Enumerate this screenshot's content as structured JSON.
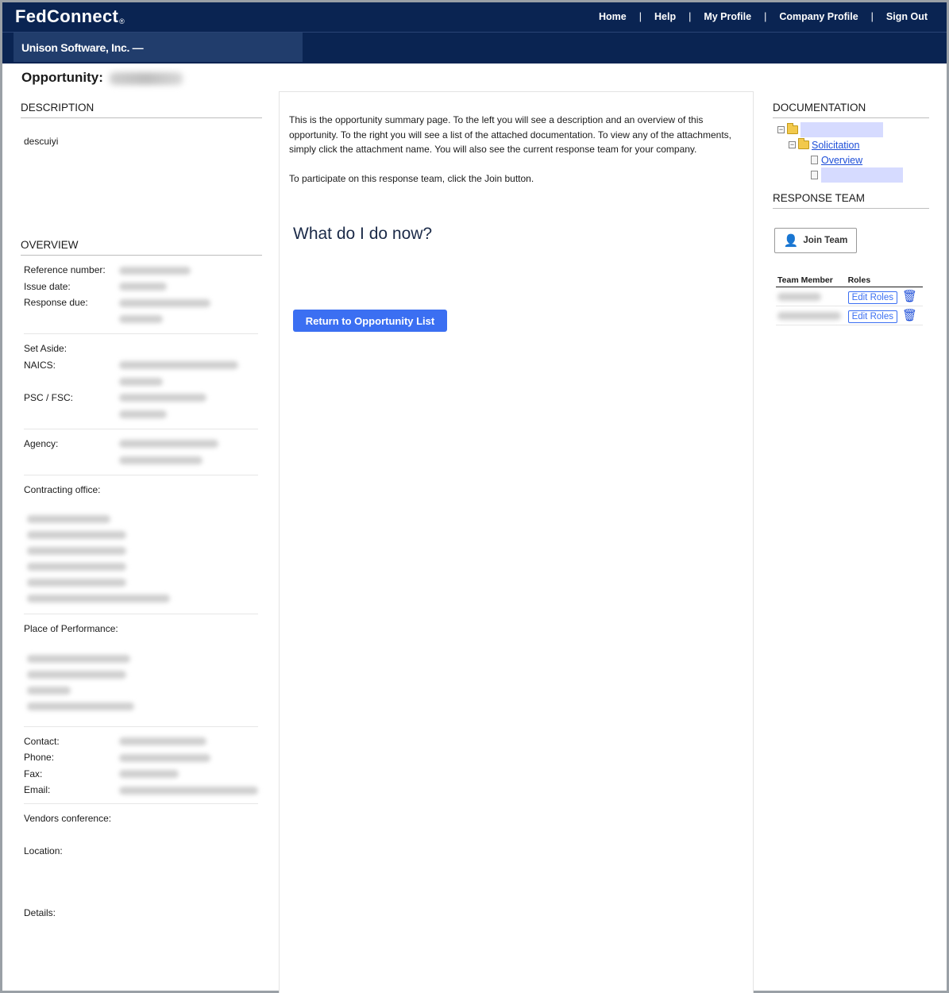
{
  "header": {
    "logo": "FedConnect",
    "logo_mark": "®",
    "nav": [
      "Home",
      "Help",
      "My Profile",
      "Company Profile",
      "Sign Out"
    ],
    "company": "Unison Software, Inc. —"
  },
  "page": {
    "title": "Opportunity:"
  },
  "description": {
    "heading": "DESCRIPTION",
    "text": "descuiyi"
  },
  "overview": {
    "heading": "OVERVIEW",
    "reference_label": "Reference number:",
    "issue_label": "Issue date:",
    "response_label": "Response due:",
    "setaside_label": "Set Aside:",
    "naics_label": "NAICS:",
    "psc_label": "PSC / FSC:",
    "agency_label": "Agency:",
    "office_label": "Contracting office:",
    "place_label": "Place of Performance:",
    "contact_label": "Contact:",
    "phone_label": "Phone:",
    "fax_label": "Fax:",
    "email_label": "Email:",
    "vendors_label": "Vendors conference:",
    "location_label": "Location:",
    "details_label": "Details:"
  },
  "summary": {
    "p1": "This is the opportunity summary page. To the left you will see a description and an overview of this opportunity. To the right you will see a list of the attached documentation. To view any of the attachments, simply click the attachment name. You will also see the current response team for your company.",
    "p2": "To participate on this response team, click the Join button.",
    "question": "What do I do now?",
    "return_button": "Return to Opportunity List"
  },
  "documentation": {
    "heading": "DOCUMENTATION",
    "folder": "Solicitation",
    "file": "Overview"
  },
  "team": {
    "heading": "RESPONSE TEAM",
    "join": "Join Team",
    "col_member": "Team Member",
    "col_roles": "Roles",
    "edit_label": "Edit Roles"
  }
}
